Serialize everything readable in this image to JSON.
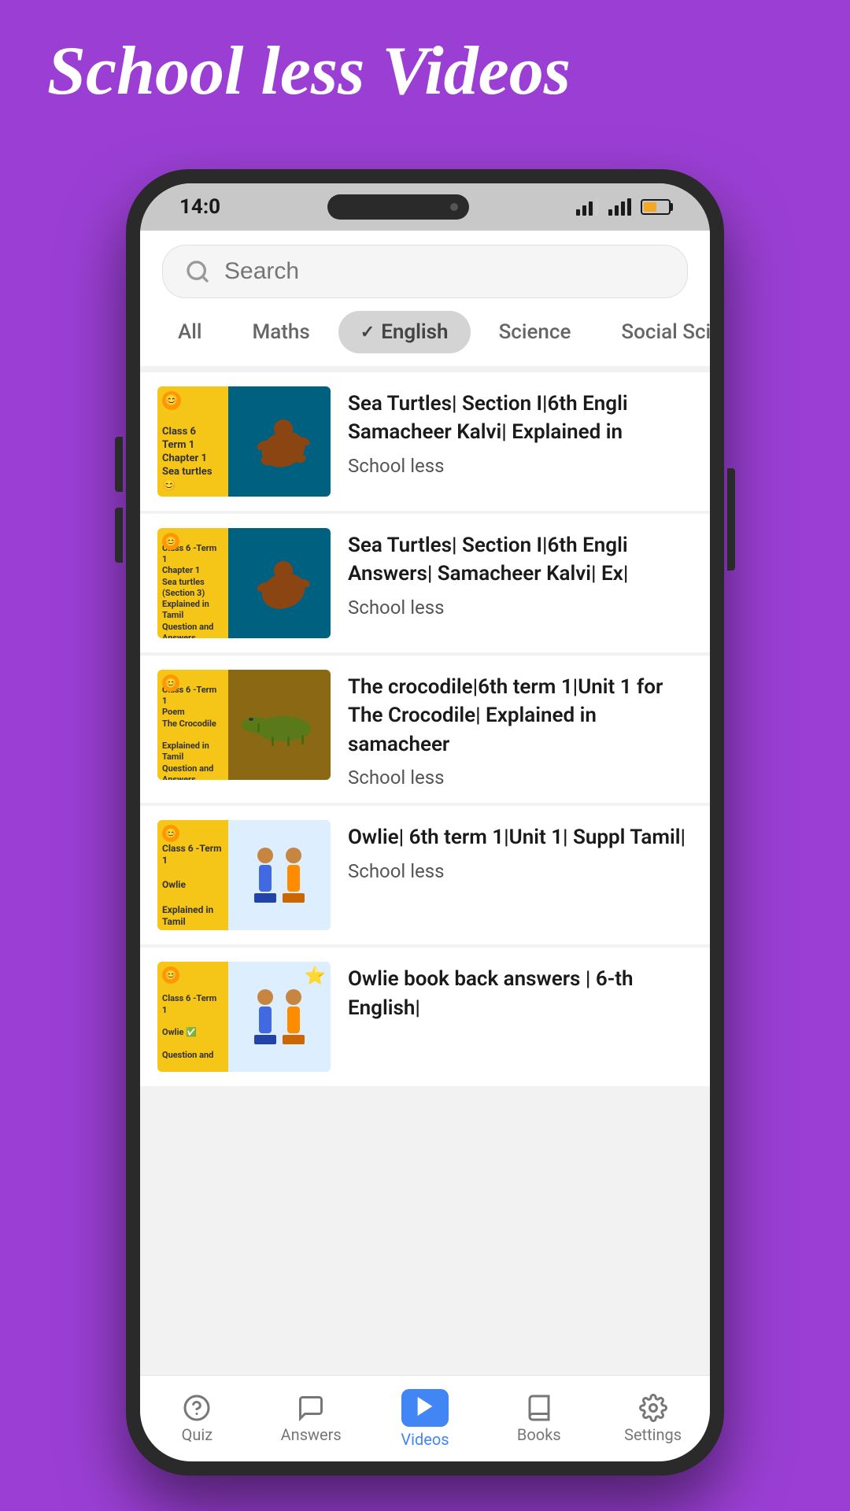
{
  "app": {
    "title": "School less Videos",
    "background_color": "#9b3fd4"
  },
  "status_bar": {
    "time": "14:0",
    "battery_level": "60%"
  },
  "search": {
    "placeholder": "Search"
  },
  "filter_tabs": [
    {
      "id": "all",
      "label": "All",
      "active": false
    },
    {
      "id": "maths",
      "label": "Maths",
      "active": false
    },
    {
      "id": "english",
      "label": "English",
      "active": true
    },
    {
      "id": "science",
      "label": "Science",
      "active": false
    },
    {
      "id": "social",
      "label": "Social Science",
      "active": false
    }
  ],
  "videos": [
    {
      "id": 1,
      "thumbnail_label": "Class 6 Term 1 Chapter 1 Sea turtles",
      "title": "Sea Turtles| Section I|6th Engli Samacheer Kalvi| Explained in",
      "channel": "School less"
    },
    {
      "id": 2,
      "thumbnail_label": "Class 6 -Term 1 Chapter 1 Sea turtles (Section 3) Explained in Tamil Question and Answers",
      "title": "Sea Turtles| Section I|6th Engli Answers| Samacheer Kalvi| Ex|",
      "channel": "School less"
    },
    {
      "id": 3,
      "thumbnail_label": "Class 6 -Term 1 Poem The Crocodile Explained in Tamil Question and Answers",
      "title": "The crocodile|6th term 1|Unit 1 for The Crocodile| Explained in samacheer",
      "channel": "School less"
    },
    {
      "id": 4,
      "thumbnail_label": "Class 6 -Term 1 Owlie Explained in Tamil",
      "title": "Owlie| 6th term 1|Unit 1| Suppl Tamil|",
      "channel": "School less"
    },
    {
      "id": 5,
      "thumbnail_label": "Class 6 -Term 1 Owlie Question and",
      "title": "Owlie book back answers | 6-th English|",
      "channel": "School less"
    }
  ],
  "bottom_nav": [
    {
      "id": "quiz",
      "label": "Quiz",
      "icon": "question-icon",
      "active": false
    },
    {
      "id": "answers",
      "label": "Answers",
      "icon": "chat-icon",
      "active": false
    },
    {
      "id": "videos",
      "label": "Videos",
      "icon": "play-icon",
      "active": true
    },
    {
      "id": "books",
      "label": "Books",
      "icon": "book-icon",
      "active": false
    },
    {
      "id": "settings",
      "label": "Settings",
      "icon": "gear-icon",
      "active": false
    }
  ]
}
